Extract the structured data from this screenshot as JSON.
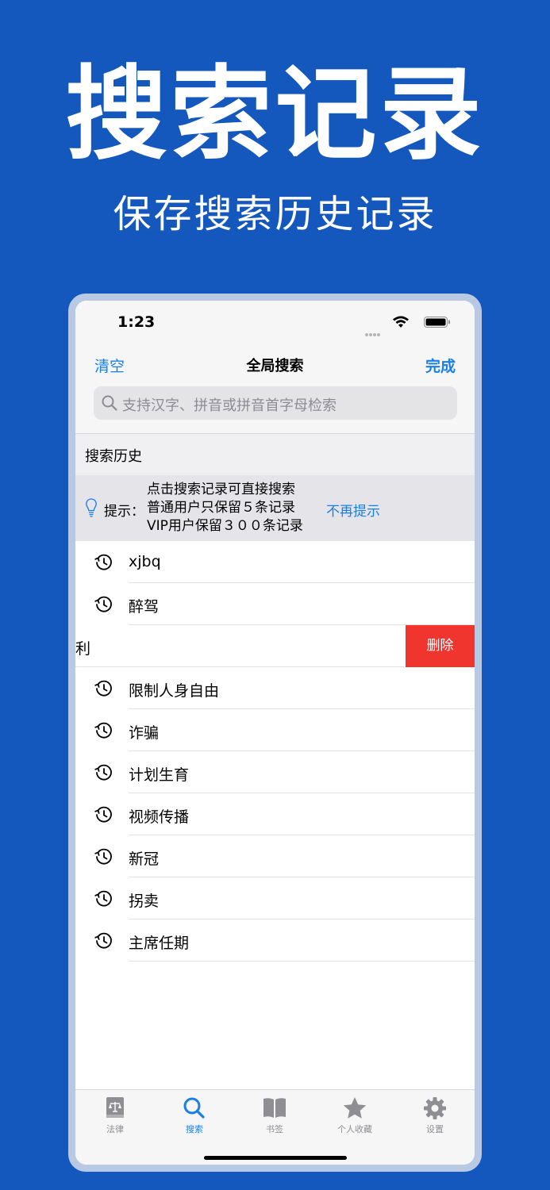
{
  "promo": {
    "title": "搜索记录",
    "subtitle": "保存搜索历史记录"
  },
  "status_bar": {
    "time": "1:23"
  },
  "nav": {
    "clear_label": "清空",
    "title": "全局搜索",
    "done_label": "完成"
  },
  "search": {
    "placeholder": "支持汉字、拼音或拼音首字母检索"
  },
  "history": {
    "section_title": "搜索历史",
    "tip": {
      "prefix": "提示：",
      "lines": [
        "点击搜索记录可直接搜索",
        "普通用户只保留５条记录",
        "VIP用户保留３００条记录"
      ],
      "dismiss": "不再提示"
    },
    "items": [
      {
        "label": "xjbq"
      },
      {
        "label": "醉驾"
      },
      {
        "label": "利",
        "swiped": true,
        "delete_label": "删除"
      },
      {
        "label": "限制人身自由"
      },
      {
        "label": "诈骗"
      },
      {
        "label": "计划生育"
      },
      {
        "label": "视频传播"
      },
      {
        "label": "新冠"
      },
      {
        "label": "拐卖"
      },
      {
        "label": "主席任期"
      }
    ]
  },
  "tabs": [
    {
      "label": "法律",
      "icon": "law-book-icon",
      "active": false
    },
    {
      "label": "搜索",
      "icon": "search-icon",
      "active": true
    },
    {
      "label": "书签",
      "icon": "book-icon",
      "active": false
    },
    {
      "label": "个人收藏",
      "icon": "star-icon",
      "active": false
    },
    {
      "label": "设置",
      "icon": "gear-icon",
      "active": false
    }
  ],
  "colors": {
    "background": "#1457bd",
    "accent": "#1a7fe6",
    "delete": "#f0352f",
    "inactive_tab": "#8e8e93"
  }
}
